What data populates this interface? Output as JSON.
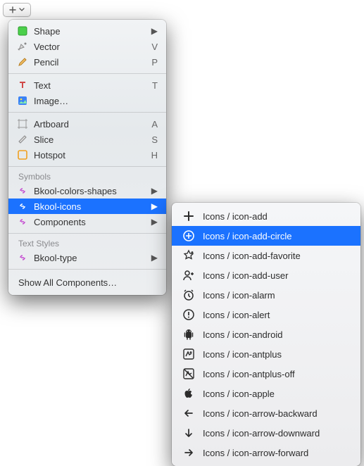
{
  "toolbar": {
    "plus_title": "Insert"
  },
  "menu": {
    "items": [
      {
        "label": "Shape",
        "icon": "shape-square-icon",
        "hasSubmenu": true
      },
      {
        "label": "Vector",
        "icon": "vector-pen-icon",
        "shortcut": "V"
      },
      {
        "label": "Pencil",
        "icon": "pencil-icon",
        "shortcut": "P"
      },
      {
        "sep": true
      },
      {
        "label": "Text",
        "icon": "text-icon",
        "shortcut": "T"
      },
      {
        "label": "Image…",
        "icon": "image-icon"
      },
      {
        "sep": true
      },
      {
        "label": "Artboard",
        "icon": "artboard-icon",
        "shortcut": "A"
      },
      {
        "label": "Slice",
        "icon": "slice-icon",
        "shortcut": "S"
      },
      {
        "label": "Hotspot",
        "icon": "hotspot-icon",
        "shortcut": "H"
      }
    ],
    "symbols_header": "Symbols",
    "symbols": [
      {
        "label": "Bkool-colors-shapes",
        "hasSubmenu": true
      },
      {
        "label": "Bkool-icons",
        "hasSubmenu": true,
        "selected": true
      },
      {
        "label": "Components",
        "hasSubmenu": true
      }
    ],
    "textstyles_header": "Text Styles",
    "textstyles": [
      {
        "label": "Bkool-type",
        "hasSubmenu": true
      }
    ],
    "show_all_label": "Show All Components…"
  },
  "submenu": {
    "items": [
      {
        "label": "Icons / icon-add",
        "icon": "icon-add"
      },
      {
        "label": "Icons / icon-add-circle",
        "icon": "icon-add-circle",
        "selected": true
      },
      {
        "label": "Icons / icon-add-favorite",
        "icon": "icon-add-favorite"
      },
      {
        "label": "Icons / icon-add-user",
        "icon": "icon-add-user"
      },
      {
        "label": "Icons / icon-alarm",
        "icon": "icon-alarm"
      },
      {
        "label": "Icons / icon-alert",
        "icon": "icon-alert"
      },
      {
        "label": "Icons / icon-android",
        "icon": "icon-android"
      },
      {
        "label": "Icons / icon-antplus",
        "icon": "icon-antplus"
      },
      {
        "label": "Icons / icon-antplus-off",
        "icon": "icon-antplus-off"
      },
      {
        "label": "Icons / icon-apple",
        "icon": "icon-apple"
      },
      {
        "label": "Icons / icon-arrow-backward",
        "icon": "icon-arrow-backward"
      },
      {
        "label": "Icons / icon-arrow-downward",
        "icon": "icon-arrow-downward"
      },
      {
        "label": "Icons / icon-arrow-forward",
        "icon": "icon-arrow-forward"
      }
    ]
  }
}
